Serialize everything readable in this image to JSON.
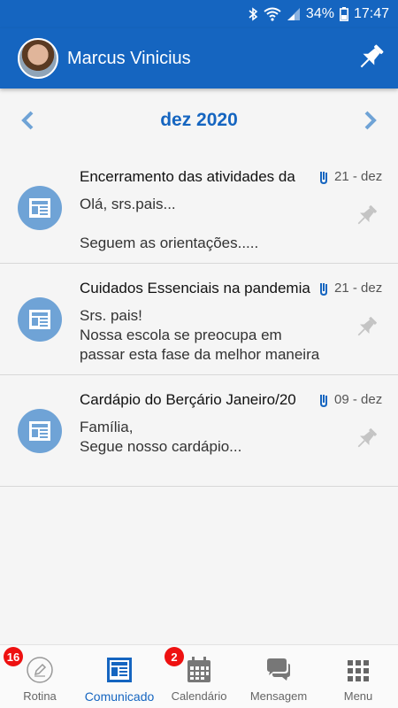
{
  "status_bar": {
    "battery": "34%",
    "time": "17:47"
  },
  "header": {
    "user_name": "Marcus Vinicius",
    "accent": "#1565c0"
  },
  "month_nav": {
    "label": "dez 2020"
  },
  "items": [
    {
      "title": "Encerramento das atividades da",
      "date": "21 - dez",
      "lines": [
        "Olá, srs.pais...",
        "",
        "Seguem as orientações....."
      ]
    },
    {
      "title": "Cuidados Essenciais na pandemia",
      "date": "21 - dez",
      "lines": [
        "Srs. pais!",
        "Nossa escola se preocupa em",
        "passar esta fase da melhor maneira"
      ]
    },
    {
      "title": "Cardápio do Berçário Janeiro/20",
      "date": "09 - dez",
      "lines": [
        "Família,",
        "Segue nosso cardápio..."
      ]
    }
  ],
  "bottom_nav": [
    {
      "label": "Rotina",
      "badge": "16",
      "icon": "pencil-icon"
    },
    {
      "label": "Comunicado",
      "badge": "",
      "icon": "newspaper-icon",
      "active": true
    },
    {
      "label": "Calendário",
      "badge": "2",
      "icon": "calendar-icon"
    },
    {
      "label": "Mensagem",
      "badge": "",
      "icon": "chat-icon"
    },
    {
      "label": "Menu",
      "badge": "",
      "icon": "grid-icon"
    }
  ]
}
